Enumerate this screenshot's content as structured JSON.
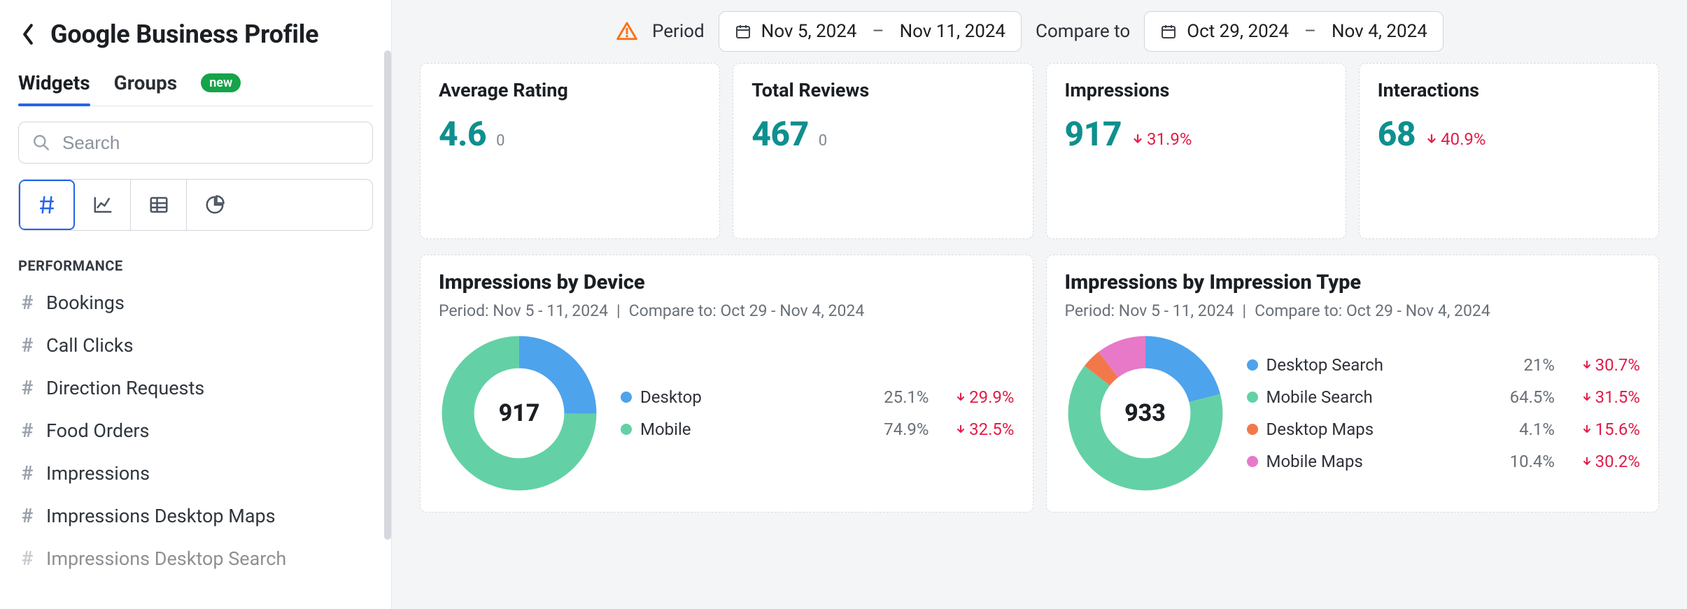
{
  "sidebar": {
    "title": "Google Business Profile",
    "tabs": [
      "Widgets",
      "Groups"
    ],
    "active_tab": 0,
    "badge": "new",
    "search_placeholder": "Search",
    "section_label": "PERFORMANCE",
    "widgets": [
      "Bookings",
      "Call Clicks",
      "Direction Requests",
      "Food Orders",
      "Impressions",
      "Impressions Desktop Maps",
      "Impressions Desktop Search"
    ]
  },
  "filters": {
    "period_label": "Period",
    "period_start": "Nov 5, 2024",
    "period_end": "Nov 11, 2024",
    "compare_label": "Compare to",
    "compare_start": "Oct 29, 2024",
    "compare_end": "Nov 4, 2024"
  },
  "kpis": [
    {
      "title": "Average Rating",
      "value": "4.6",
      "sub": "0",
      "delta": ""
    },
    {
      "title": "Total Reviews",
      "value": "467",
      "sub": "0",
      "delta": ""
    },
    {
      "title": "Impressions",
      "value": "917",
      "sub": "",
      "delta": "31.9%"
    },
    {
      "title": "Interactions",
      "value": "68",
      "sub": "",
      "delta": "40.9%"
    }
  ],
  "donuts": [
    {
      "title": "Impressions by Device",
      "period": "Period: Nov 5 - 11, 2024",
      "compare": "Compare to: Oct 29 - Nov 4, 2024",
      "center": "917",
      "legend": [
        {
          "name": "Desktop",
          "pct": "25.1%",
          "delta": "29.9%",
          "color": "c-blue"
        },
        {
          "name": "Mobile",
          "pct": "74.9%",
          "delta": "32.5%",
          "color": "c-green"
        }
      ]
    },
    {
      "title": "Impressions by Impression Type",
      "period": "Period: Nov 5 - 11, 2024",
      "compare": "Compare to: Oct 29 - Nov 4, 2024",
      "center": "933",
      "legend": [
        {
          "name": "Desktop Search",
          "pct": "21%",
          "delta": "30.7%",
          "color": "c-blue"
        },
        {
          "name": "Mobile Search",
          "pct": "64.5%",
          "delta": "31.5%",
          "color": "c-green"
        },
        {
          "name": "Desktop Maps",
          "pct": "4.1%",
          "delta": "15.6%",
          "color": "c-orange"
        },
        {
          "name": "Mobile Maps",
          "pct": "10.4%",
          "delta": "30.2%",
          "color": "c-pink"
        }
      ]
    }
  ],
  "chart_data": [
    {
      "type": "pie",
      "title": "Impressions by Device",
      "total": 917,
      "series": [
        {
          "name": "Desktop",
          "value": 25.1,
          "change_pct": -29.9
        },
        {
          "name": "Mobile",
          "value": 74.9,
          "change_pct": -32.5
        }
      ]
    },
    {
      "type": "pie",
      "title": "Impressions by Impression Type",
      "total": 933,
      "series": [
        {
          "name": "Desktop Search",
          "value": 21.0,
          "change_pct": -30.7
        },
        {
          "name": "Mobile Search",
          "value": 64.5,
          "change_pct": -31.5
        },
        {
          "name": "Desktop Maps",
          "value": 4.1,
          "change_pct": -15.6
        },
        {
          "name": "Mobile Maps",
          "value": 10.4,
          "change_pct": -30.2
        }
      ]
    }
  ],
  "colors": {
    "c-blue": "#4ea3ed",
    "c-green": "#63d1a5",
    "c-orange": "#f2784b",
    "c-pink": "#e879c8"
  }
}
